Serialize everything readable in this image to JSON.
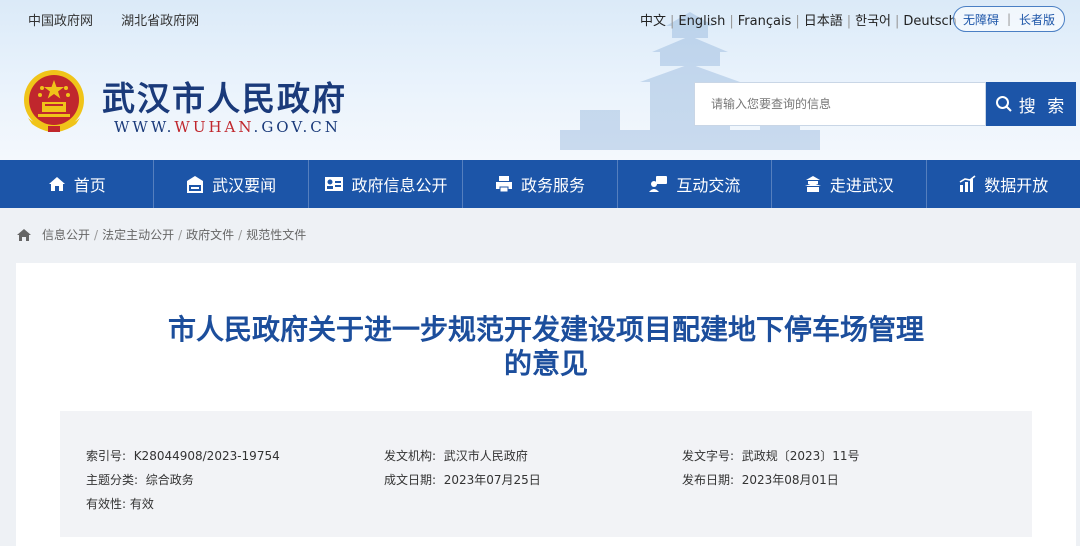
{
  "top_links": [
    "中国政府网",
    "湖北省政府网"
  ],
  "languages": [
    "中文",
    "English",
    "Français",
    "日本語",
    "한국어",
    "Deutsch"
  ],
  "accessibility": {
    "barrier_free": "无障碍",
    "elder": "长者版"
  },
  "site": {
    "title": "武汉市人民政府",
    "url_prefix": "WWW.",
    "url_highlight": "WUHAN",
    "url_suffix": ".GOV.CN"
  },
  "search": {
    "placeholder": "请输入您要查询的信息",
    "button": "搜 索"
  },
  "nav": [
    {
      "label": "首页",
      "icon": "home-icon"
    },
    {
      "label": "武汉要闻",
      "icon": "building-icon"
    },
    {
      "label": "政府信息公开",
      "icon": "id-card-icon"
    },
    {
      "label": "政务服务",
      "icon": "printer-icon"
    },
    {
      "label": "互动交流",
      "icon": "chat-user-icon"
    },
    {
      "label": "走进武汉",
      "icon": "landmark-icon"
    },
    {
      "label": "数据开放",
      "icon": "chart-icon"
    }
  ],
  "breadcrumb": [
    "信息公开",
    "法定主动公开",
    "政府文件",
    "规范性文件"
  ],
  "document": {
    "title_line1": "市人民政府关于进一步规范开发建设项目配建地下停车场管理",
    "title_line2": "的意见",
    "meta": {
      "index_label": "索引号:",
      "index_value": "K28044908/2023-19754",
      "issuer_label": "发文机构:",
      "issuer_value": "武汉市人民政府",
      "docno_label": "发文字号:",
      "docno_value": "武政规〔2023〕11号",
      "category_label": "主题分类:",
      "category_value": "综合政务",
      "created_label": "成文日期:",
      "created_value": "2023年07月25日",
      "published_label": "发布日期:",
      "published_value": "2023年08月01日",
      "validity_label": "有效性:",
      "validity_value": "有效"
    }
  },
  "colors": {
    "primary": "#1c55a8",
    "title": "#1c4e9c",
    "emblem_red": "#c0272d",
    "emblem_gold": "#f0c419"
  }
}
